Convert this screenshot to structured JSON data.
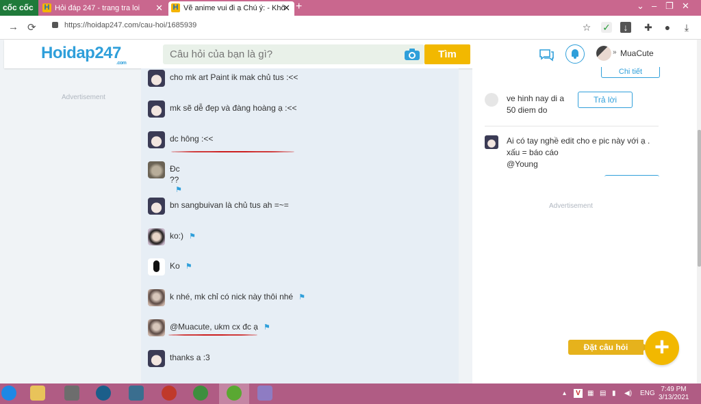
{
  "browser": {
    "brand": "cốc cốc",
    "tabs": [
      {
        "title": "Hỏi đáp 247 - trang tra loi",
        "close": "✕"
      },
      {
        "title": "Vẽ anime vui đi ạ Chú ý: - Khô",
        "close": "✕"
      }
    ],
    "new_tab": "+",
    "url": "https://hoidap247.com/cau-hoi/1685939"
  },
  "site": {
    "logo": "Hoidap247",
    "logo_suffix": ".com",
    "search_placeholder": "Câu hỏi của bạn là gì?",
    "search_button": "Tìm",
    "username": "MuaCute",
    "accent_color": "#2f9fda",
    "button_color": "#f2b800"
  },
  "left_ad": "Advertisement",
  "comments": [
    {
      "text": "cho mk art Paint ik mak chủ tus :<<",
      "avatar": "anime",
      "flag": false
    },
    {
      "text": "mk sẽ dễ đẹp và đàng hoàng ạ :<<",
      "avatar": "anime",
      "flag": false
    },
    {
      "text": "dc hông :<<",
      "avatar": "anime",
      "flag": false
    },
    {
      "text": "Đc",
      "text2": "??",
      "avatar": "cat",
      "flag": true
    },
    {
      "text": "bn sangbuivan là chủ tus ah =~=",
      "avatar": "anime",
      "flag": false
    },
    {
      "text": "ko:)",
      "avatar": "girl",
      "flag": true
    },
    {
      "text": "Ko",
      "avatar": "mask",
      "flag": true
    },
    {
      "text": "k nhé, mk chỉ có nick này thôi nhé",
      "avatar": "photo",
      "flag": true
    },
    {
      "text": "@Muacute, ukm cx đc ạ",
      "avatar": "photo",
      "flag": true
    },
    {
      "text": "thanks a :3",
      "avatar": "anime",
      "flag": false
    }
  ],
  "sidebar": {
    "detail_button": "Chi tiết",
    "question1_line1": "ve hinh nay di a",
    "question1_line2": "50 diem do",
    "reply_button": "Trả lời",
    "question2_line1": "Ai có tay nghề edit cho e pic này với ạ .",
    "question2_line2": "xấu = báo cáo",
    "question2_line3": "@Young",
    "ad": "Advertisement"
  },
  "ask_button": "Đặt câu hỏi",
  "ask_plus": "+",
  "taskbar": {
    "lang": "ENG",
    "time": "7:49 PM",
    "date": "3/13/2021"
  }
}
